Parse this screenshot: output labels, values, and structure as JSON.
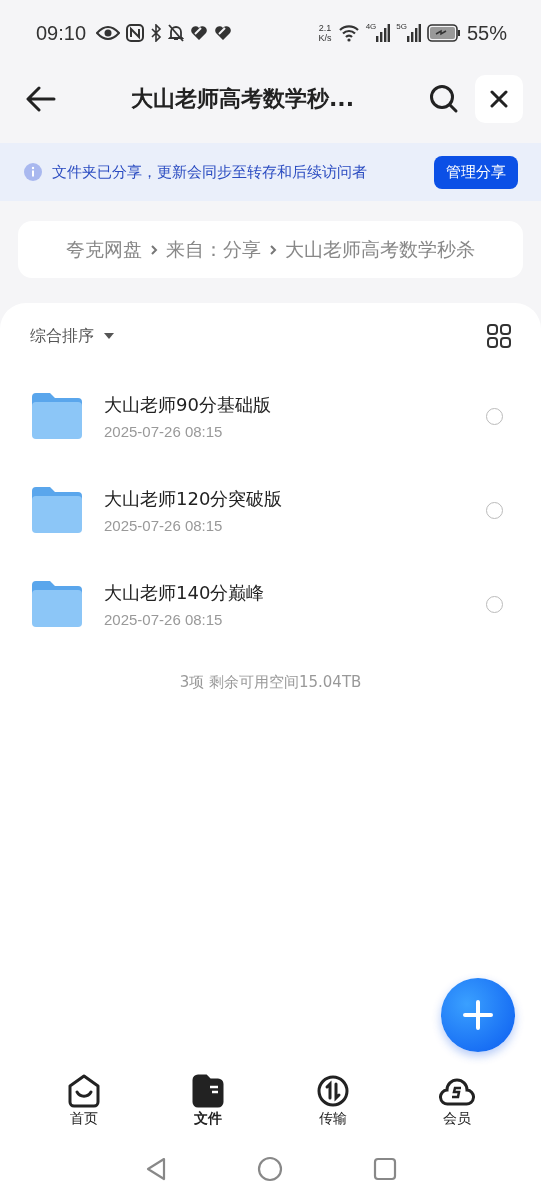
{
  "status_bar": {
    "time": "09:10",
    "speed_value": "2.1",
    "speed_unit": "K/s",
    "network_a": "4G",
    "network_b": "5G",
    "battery": "55%"
  },
  "header": {
    "title": "大山老师高考数学秒..."
  },
  "share_banner": {
    "text": "文件夹已分享，更新会同步至转存和后续访问者",
    "button": "管理分享"
  },
  "breadcrumb": [
    {
      "label": "夸克网盘"
    },
    {
      "label": "来自：分享"
    },
    {
      "label": "大山老师高考数学秒杀"
    }
  ],
  "sort": {
    "label": "综合排序"
  },
  "files": [
    {
      "name": "大山老师90分基础版",
      "date": "2025-07-26 08:15",
      "selected": false
    },
    {
      "name": "大山老师120分突破版",
      "date": "2025-07-26 08:15",
      "selected": false
    },
    {
      "name": "大山老师140分巅峰",
      "date": "2025-07-26 08:15",
      "selected": false
    }
  ],
  "summary": "3项 剩余可用空间15.04TB",
  "tabs": [
    {
      "label": "首页",
      "selected": false
    },
    {
      "label": "文件",
      "selected": true
    },
    {
      "label": "传输",
      "selected": false
    },
    {
      "label": "会员",
      "selected": false
    }
  ]
}
